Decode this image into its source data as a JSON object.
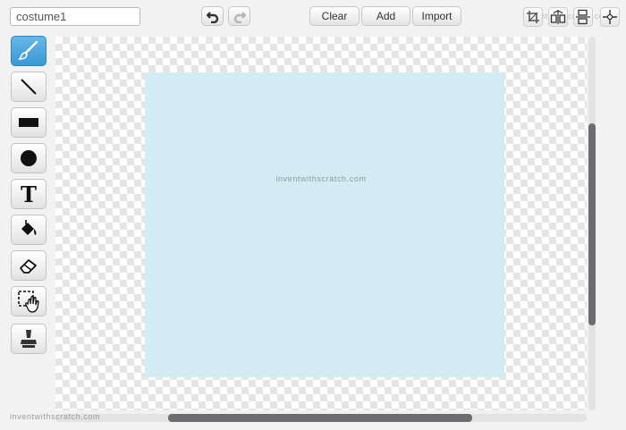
{
  "costume": {
    "name": "costume1"
  },
  "toolbar": {
    "clear_label": "Clear",
    "add_label": "Add",
    "import_label": "Import"
  },
  "tools": [
    {
      "name": "brush-icon",
      "selected": true
    },
    {
      "name": "line-icon"
    },
    {
      "name": "rectangle-icon"
    },
    {
      "name": "ellipse-icon"
    },
    {
      "name": "text-icon",
      "glyph": "T"
    },
    {
      "name": "fill-bucket-icon"
    },
    {
      "name": "eraser-icon"
    },
    {
      "name": "select-icon"
    },
    {
      "name": "stamp-icon"
    }
  ],
  "top_icons": [
    "undo-icon",
    "redo-icon",
    "crop-icon",
    "flip-horizontal-icon",
    "flip-vertical-icon",
    "set-costume-center-icon"
  ],
  "watermark": "inventwithscratch.com",
  "colors": {
    "selected_tool": "#3a98d3",
    "costume_fill": "#d3ecf4"
  }
}
